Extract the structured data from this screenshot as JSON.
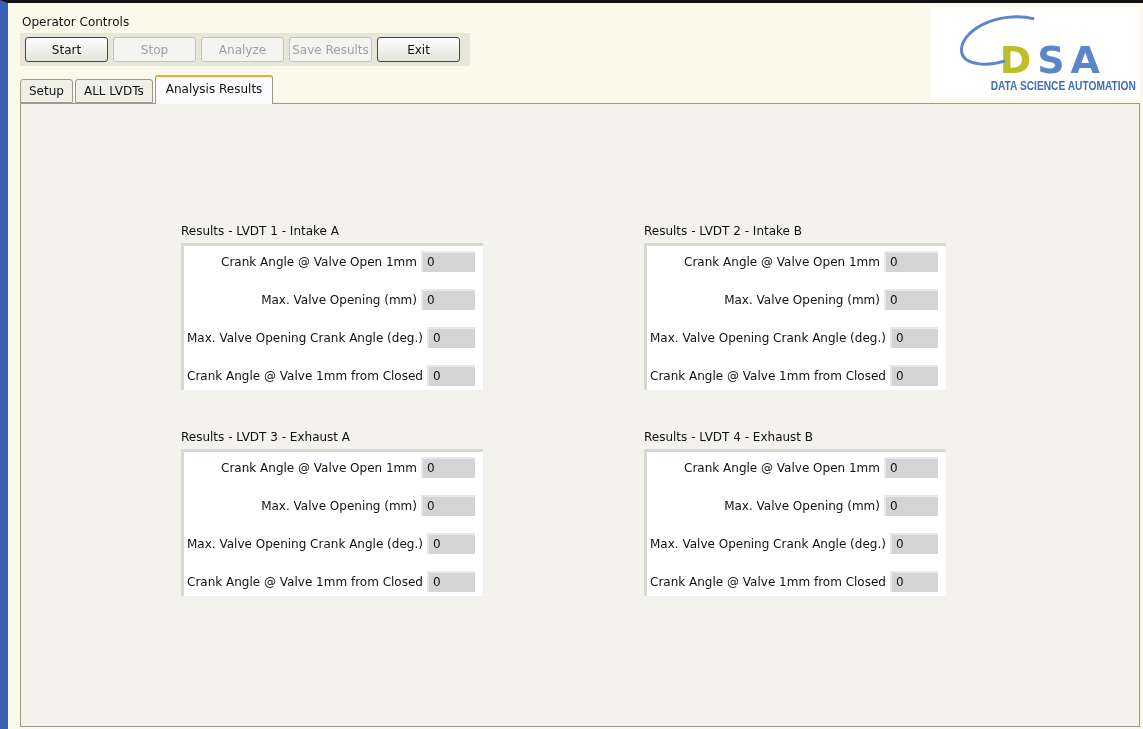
{
  "header": {
    "title": "Operator Controls"
  },
  "buttons": [
    {
      "label": "Start",
      "disabled": false
    },
    {
      "label": "Stop",
      "disabled": true
    },
    {
      "label": "Analyze",
      "disabled": true
    },
    {
      "label": "Save Results",
      "disabled": true
    },
    {
      "label": "Exit",
      "disabled": false
    }
  ],
  "logo": {
    "mark": "DSA",
    "tagline": "DATA SCIENCE AUTOMATION"
  },
  "tabs": [
    {
      "label": "Setup",
      "selected": false
    },
    {
      "label": "ALL LVDTs",
      "selected": false
    },
    {
      "label": "Analysis Results",
      "selected": true
    }
  ],
  "groups": [
    {
      "title": "Results - LVDT 1 - Intake A",
      "fields": [
        {
          "label": "Crank Angle @ Valve Open 1mm",
          "value": "0"
        },
        {
          "label": "Max. Valve Opening (mm)",
          "value": "0"
        },
        {
          "label": "Max. Valve Opening Crank Angle (deg.)",
          "value": "0"
        },
        {
          "label": "Crank Angle @ Valve 1mm from Closed",
          "value": "0"
        }
      ]
    },
    {
      "title": "Results - LVDT 2 - Intake B",
      "fields": [
        {
          "label": "Crank Angle @ Valve Open 1mm",
          "value": "0"
        },
        {
          "label": "Max. Valve Opening (mm)",
          "value": "0"
        },
        {
          "label": "Max. Valve Opening Crank Angle (deg.)",
          "value": "0"
        },
        {
          "label": "Crank Angle @ Valve 1mm from Closed",
          "value": "0"
        }
      ]
    },
    {
      "title": "Results - LVDT 3 - Exhaust A",
      "fields": [
        {
          "label": "Crank Angle @ Valve Open 1mm",
          "value": "0"
        },
        {
          "label": "Max. Valve Opening (mm)",
          "value": "0"
        },
        {
          "label": "Max. Valve Opening Crank Angle (deg.)",
          "value": "0"
        },
        {
          "label": "Crank Angle @ Valve 1mm from Closed",
          "value": "0"
        }
      ]
    },
    {
      "title": "Results - LVDT 4 - Exhaust B",
      "fields": [
        {
          "label": "Crank Angle @ Valve Open 1mm",
          "value": "0"
        },
        {
          "label": "Max. Valve Opening (mm)",
          "value": "0"
        },
        {
          "label": "Max. Valve Opening Crank Angle (deg.)",
          "value": "0"
        },
        {
          "label": "Crank Angle @ Valve 1mm from Closed",
          "value": "0"
        }
      ]
    }
  ]
}
